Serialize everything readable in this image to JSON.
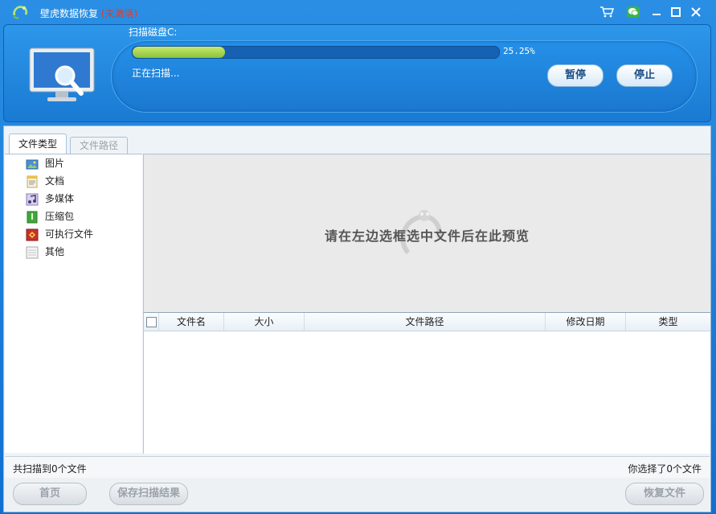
{
  "window": {
    "title": "壁虎数据恢复",
    "status_tag": "(未激活)"
  },
  "titlebar_icons": [
    "cart-icon",
    "wechat-icon",
    "minimize-icon",
    "maximize-icon",
    "close-icon"
  ],
  "scan": {
    "label": "扫描磁盘C:",
    "progress_percent": 25.25,
    "progress_text": "25.25%",
    "status": "正在扫描...",
    "pause_label": "暂停",
    "stop_label": "停止"
  },
  "tabs": [
    {
      "label": "文件类型",
      "active": true
    },
    {
      "label": "文件路径",
      "active": false
    }
  ],
  "categories": [
    {
      "label": "图片",
      "icon": "image-icon"
    },
    {
      "label": "文档",
      "icon": "document-icon"
    },
    {
      "label": "多媒体",
      "icon": "music-icon"
    },
    {
      "label": "压缩包",
      "icon": "archive-icon"
    },
    {
      "label": "可执行文件",
      "icon": "executable-icon"
    },
    {
      "label": "其他",
      "icon": "other-file-icon"
    }
  ],
  "preview": {
    "hint": "请在左边选框选中文件后在此预览"
  },
  "table": {
    "columns": [
      "文件名",
      "大小",
      "文件路径",
      "修改日期",
      "类型"
    ],
    "rows": []
  },
  "footer": {
    "scanned": "共扫描到0个文件",
    "selected": "你选择了0个文件"
  },
  "buttons": {
    "home": "首页",
    "save_scan": "保存扫描结果",
    "recover": "恢复文件"
  },
  "colors": {
    "accent": "#1a7fd6",
    "progress": "#9ccd45",
    "warning": "#e23b2a"
  }
}
